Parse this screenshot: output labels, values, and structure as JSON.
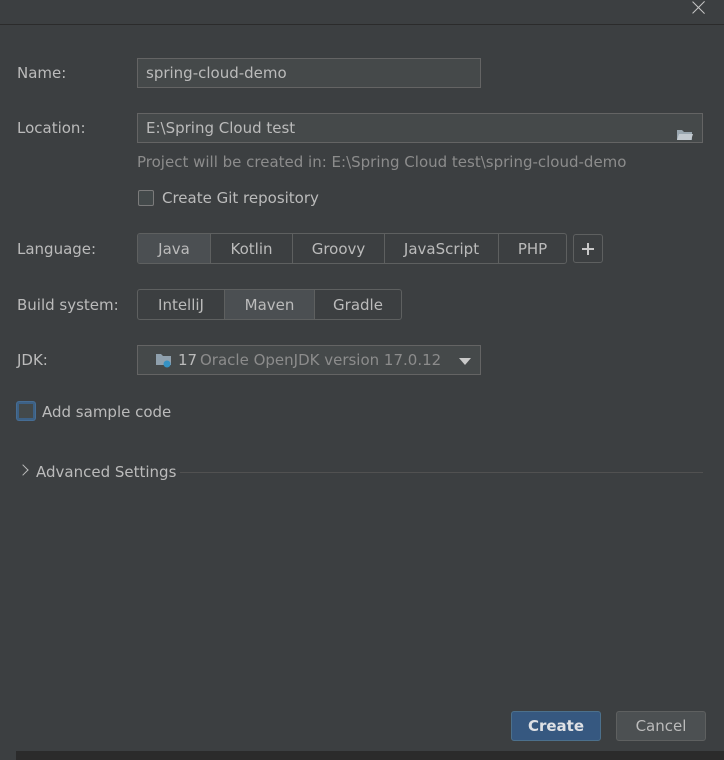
{
  "form": {
    "name_label": "Name:",
    "name_value": "spring-cloud-demo",
    "location_label": "Location:",
    "location_value": "E:\\Spring Cloud test",
    "location_hint": "Project will be created in: E:\\Spring Cloud test\\spring-cloud-demo",
    "git_label": "Create Git repository",
    "git_checked": false,
    "language_label": "Language:",
    "languages": [
      "Java",
      "Kotlin",
      "Groovy",
      "JavaScript",
      "PHP"
    ],
    "language_selected": "Java",
    "build_label": "Build system:",
    "build_systems": [
      "IntelliJ",
      "Maven",
      "Gradle"
    ],
    "build_selected": "Maven",
    "jdk_label": "JDK:",
    "jdk_version": "17",
    "jdk_description": "Oracle OpenJDK version 17.0.12",
    "sample_label": "Add sample code",
    "sample_checked": false,
    "advanced_label": "Advanced Settings"
  },
  "buttons": {
    "create": "Create",
    "cancel": "Cancel"
  },
  "icons": {
    "close": "close-icon",
    "folder": "folder-icon",
    "add": "plus-icon",
    "dropdown": "chevron-down-icon",
    "expand": "chevron-right-icon",
    "jdk": "jdk-folder-icon"
  },
  "colors": {
    "background": "#3c3f41",
    "primary_button": "#365880",
    "focus_ring": "#3d6185"
  }
}
